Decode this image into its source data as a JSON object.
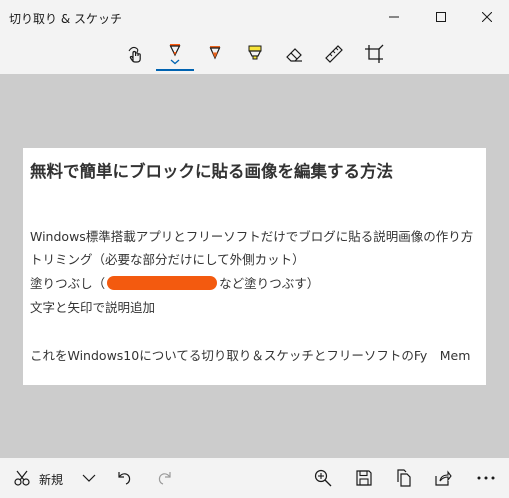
{
  "window": {
    "title": "切り取り & スケッチ"
  },
  "toolbar": {
    "tools": [
      {
        "name": "touch-writing",
        "icon": "touch-writing-icon"
      },
      {
        "name": "ballpoint-pen",
        "icon": "ballpoint-pen-icon",
        "color": "#ff5a0f",
        "selected": true
      },
      {
        "name": "pencil",
        "icon": "pencil-icon",
        "color": "#e8621c"
      },
      {
        "name": "highlighter",
        "icon": "highlighter-icon",
        "color": "#f7e43a"
      },
      {
        "name": "eraser",
        "icon": "eraser-icon"
      },
      {
        "name": "ruler",
        "icon": "ruler-icon"
      },
      {
        "name": "crop",
        "icon": "crop-icon"
      }
    ],
    "accent": "#0063b1"
  },
  "image": {
    "heading": "無料で簡単にブロックに貼る画像を編集する方法",
    "lines": [
      "Windows標準搭載アプリとフリーソフトだけでブログに貼る説明画像の作り方",
      "トリミング（必要な部分だけにして外側カット）",
      "塗りつぶし（",
      "など塗りつぶす）",
      "文字と矢印で説明追加",
      "これをWindows10についてる切り取り＆スケッチとフリーソフトのFy　Mem"
    ],
    "redaction_color": "#f35a0f"
  },
  "bottombar": {
    "new_label": "新規"
  }
}
